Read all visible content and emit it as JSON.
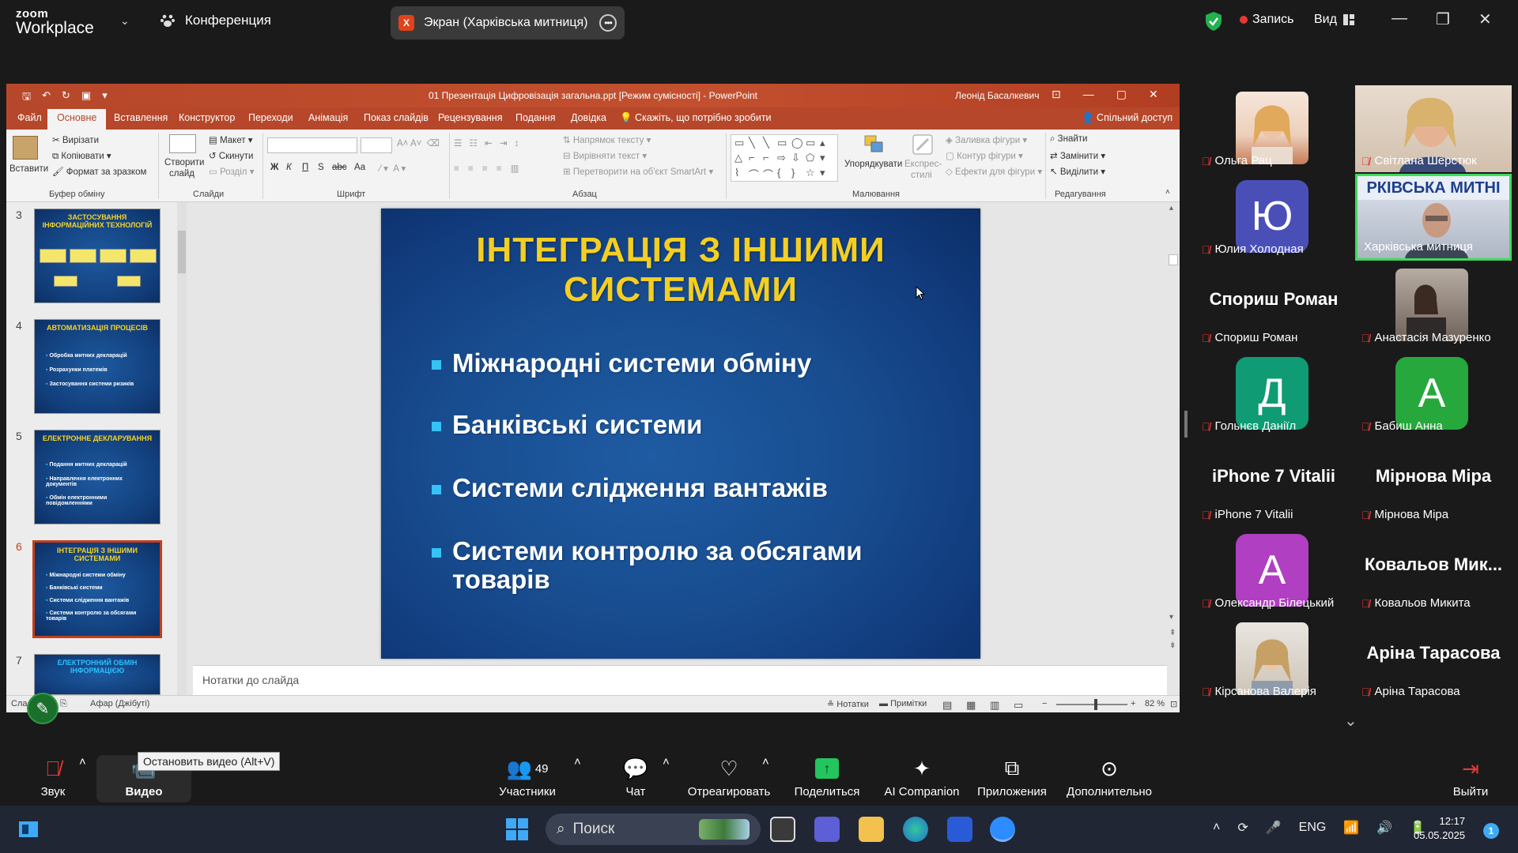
{
  "zoom": {
    "logo_top": "zoom",
    "logo_bottom": "Workplace",
    "meeting_label": "Конференция",
    "share_badge": "X",
    "share_label": "Экран (Харківська митниця)",
    "record_label": "Запись",
    "view_label": "Вид"
  },
  "ppt": {
    "doc_title": "01 Презентація Цифровізація загальна.ppt [Режим сумісності]  -  PowerPoint",
    "user_name": "Леонід Басалкевич",
    "tabs": [
      "Файл",
      "Основне",
      "Вставлення",
      "Конструктор",
      "Переходи",
      "Анімація",
      "Показ слайдів",
      "Рецензування",
      "Подання",
      "Довідка",
      "Скажіть, що потрібно зробити"
    ],
    "share_access": "Спільний доступ",
    "ribbon": {
      "paste": "Вставити",
      "cut": "Вирізати",
      "copy": "Копіювати",
      "format_painter": "Формат за зразком",
      "clipboard_group": "Буфер обміну",
      "new_slide_1": "Створити",
      "new_slide_2": "слайд",
      "layout": "Макет",
      "reset": "Скинути",
      "section": "Розділ",
      "slides_group": "Слайди",
      "font_group": "Шрифт",
      "text_direction": "Напрямок тексту",
      "align_text": "Вирівняти текст",
      "smartart": "Перетворити на об'єкт SmartArt",
      "paragraph_group": "Абзац",
      "arrange": "Упорядкувати",
      "quick_styles_1": "Експрес-",
      "quick_styles_2": "стилі",
      "shape_fill": "Заливка фігури",
      "shape_outline": "Контур фігури",
      "shape_effects": "Ефекти для фігури",
      "drawing_group": "Малювання",
      "find": "Знайти",
      "replace": "Замінити",
      "select": "Виділити",
      "editing_group": "Редагування",
      "bold": "Ж",
      "italic": "К",
      "underline": "П",
      "shadow": "S",
      "strike": "abc",
      "case": "Аа"
    },
    "thumbnails": [
      {
        "num": "3",
        "title": "ЗАСТОСУВАННЯ ІНФОРМАЦІЙНИХ ТЕХНОЛОГІЙ",
        "lines": []
      },
      {
        "num": "4",
        "title": "АВТОМАТИЗАЦІЯ ПРОЦЕСІВ",
        "lines": [
          "Обробка митних декларацій",
          "Розрахунки платежів",
          "Застосування системи ризиків"
        ]
      },
      {
        "num": "5",
        "title": "ЕЛЕКТРОННЕ ДЕКЛАРУВАННЯ",
        "lines": [
          "Подання митних декларацій",
          "Направлення електронних документів",
          "Обмін електронними повідомленнями"
        ]
      },
      {
        "num": "6",
        "title": "ІНТЕГРАЦІЯ З ІНШИМИ СИСТЕМАМИ",
        "lines": [
          "Міжнародні системи обміну",
          "Банківські системи",
          "Системи слідження вантажів",
          "Системи контролю за обсягами товарів"
        ]
      },
      {
        "num": "7",
        "title": "ЕЛЕКТРОННИЙ ОБМІН ІНФОРМАЦІЄЮ",
        "lines": []
      }
    ],
    "slide": {
      "title_line1": "ІНТЕГРАЦІЯ З ІНШИМИ",
      "title_line2": "СИСТЕМАМИ",
      "bullets": [
        "Міжнародні системи обміну",
        "Банківські системи",
        "Системи слідження вантажів",
        "Системи контролю за обсягами товарів"
      ]
    },
    "notes_placeholder": "Нотатки до слайда",
    "status": {
      "slide_label": "Сла",
      "theme": "Афар (Джібуті)",
      "notes": "Нотатки",
      "comments": "Примітки",
      "zoom": "82 %"
    }
  },
  "participants": [
    {
      "name": "Ольга Рац",
      "type": "photo",
      "photo_colors": [
        "#f2d7c4",
        "#e7b48c"
      ]
    },
    {
      "name": "Світлана Шерстюк",
      "type": "photo",
      "photo_colors": [
        "#d9c9b8",
        "#c48a6a"
      ]
    },
    {
      "name": "Юлия Холодная",
      "type": "letter",
      "letter": "Ю",
      "color": "#4a4fb8"
    },
    {
      "name": "Харківська митниця",
      "type": "photo",
      "banner": "РКІВСЬКА МИТНІ",
      "speaking": true
    },
    {
      "name": "Спориш Роман",
      "type": "text",
      "big": "Спориш Роман"
    },
    {
      "name": "Анастасія Мазуренко",
      "type": "photo",
      "photo_colors": [
        "#9a8a7c",
        "#3b3029"
      ]
    },
    {
      "name": "Гольнєв Даніїл",
      "type": "letter",
      "letter": "Д",
      "color": "#0f9b74"
    },
    {
      "name": "Бабиш Анна",
      "type": "letter",
      "letter": "А",
      "color": "#27a83d"
    },
    {
      "name": "iPhone 7 Vitalii",
      "type": "text",
      "big": "iPhone 7 Vitalii"
    },
    {
      "name": "Мірнова Міра",
      "type": "text",
      "big": "Мірнова Міра"
    },
    {
      "name": "Олександр Білецький",
      "type": "letter",
      "letter": "А",
      "color": "#b03fc1"
    },
    {
      "name": "Ковальов Микита",
      "type": "text",
      "big": "Ковальов Мик..."
    },
    {
      "name": "Кірсанова Валерія",
      "type": "photo",
      "photo_colors": [
        "#d8d2c8",
        "#8a6c44"
      ]
    },
    {
      "name": "Аріна Тарасова",
      "type": "text",
      "big": "Аріна Тарасова"
    }
  ],
  "toolbar": {
    "audio": "Звук",
    "video": "Видео",
    "video_tooltip": "Остановить видео (Alt+V)",
    "participants": "Участники",
    "participants_count": "49",
    "chat": "Чат",
    "react": "Отреагировать",
    "share": "Поделиться",
    "ai": "AI Companion",
    "apps": "Приложения",
    "more": "Дополнительно",
    "leave": "Выйти"
  },
  "taskbar": {
    "search": "Поиск",
    "lang": "ENG",
    "time": "12:17",
    "date": "05.05.2025",
    "notifications": "1"
  },
  "colors": {
    "ppt_accent": "#b7472a",
    "slide_title": "#f4cf22",
    "zoom_bg": "#1a1a1a",
    "speaking": "#3ddc5a"
  }
}
